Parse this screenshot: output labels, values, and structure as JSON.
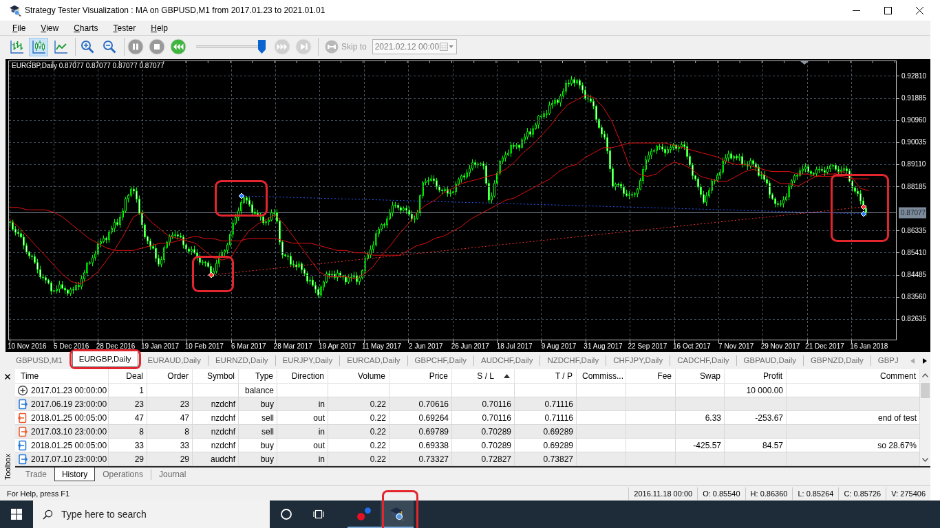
{
  "window": {
    "title": "Strategy Tester Visualization : MA on GBPUSD,M1 from 2017.01.23 to 2021.01.01"
  },
  "menu": [
    "File",
    "View",
    "Charts",
    "Tester",
    "Help"
  ],
  "toolbar": {
    "chart_modes": [
      {
        "kind": "bars",
        "selected": false
      },
      {
        "kind": "candles",
        "selected": true
      },
      {
        "kind": "line",
        "selected": false
      }
    ],
    "zoom": [
      {
        "kind": "zoom-in"
      },
      {
        "kind": "zoom-out"
      }
    ],
    "playback": [
      {
        "kind": "pause",
        "disabled": false
      },
      {
        "kind": "stop",
        "disabled": false
      },
      {
        "kind": "rewind",
        "disabled": false
      }
    ],
    "speed": {
      "level": 0.96
    },
    "stepping": [
      {
        "kind": "fast-forward",
        "disabled": true
      },
      {
        "kind": "skip-end",
        "disabled": true
      }
    ],
    "skip_to": {
      "label": "Skip to",
      "disabled": true
    },
    "date_field": {
      "value": "2021.02.12 00:00",
      "disabled": true
    }
  },
  "chart": {
    "info": "EURGBP,Daily 0.87077 0.87077 0.87077 0.87077",
    "current_price": "0.87077",
    "chart_data": {
      "type": "line",
      "grid": true,
      "categories": [
        null,
        null,
        "10 Nov 2016",
        null,
        null,
        null,
        null,
        "5 Dec 2016",
        null,
        null,
        null,
        null,
        "28 Dec 2016",
        null,
        null,
        null,
        null,
        "19 Jan 2017",
        null,
        null,
        null,
        null,
        "10 Feb 2017",
        null,
        null,
        null,
        null,
        "6 Mar 2017",
        null,
        null,
        null,
        null,
        "28 Mar 2017",
        null,
        null,
        null,
        null,
        "19 Apr 2017",
        null,
        null,
        null,
        null,
        "11 May 2017",
        null,
        null,
        null,
        null,
        "2 Jun 2017",
        null,
        null,
        null,
        null,
        "26 Jun 2017",
        null,
        null,
        null,
        null,
        "18 Jul 2017",
        null,
        null,
        null,
        null,
        "9 Aug 2017",
        null,
        null,
        null,
        null,
        "31 Aug 2017",
        null,
        null,
        null,
        null,
        "22 Sep 2017",
        null,
        null,
        null,
        null,
        "16 Oct 2017",
        null,
        null,
        null,
        null,
        "7 Nov 2017",
        null,
        null,
        null,
        null,
        "29 Nov 2017",
        null,
        null,
        null,
        null,
        "21 Dec 2017",
        null,
        null,
        null,
        null,
        "16 Jan 2018"
      ],
      "ylim": [
        0.8175,
        0.9344
      ],
      "yticks": [
        {
          "value": 0.9281,
          "label": "0.92810"
        },
        {
          "value": 0.91885,
          "label": "0.91885"
        },
        {
          "value": 0.9096,
          "label": "0.90960"
        },
        {
          "value": 0.90035,
          "label": "0.90035"
        },
        {
          "value": 0.8911,
          "label": "0.89110"
        },
        {
          "value": 0.88185,
          "label": "0.88185"
        },
        {
          "value": 0.86335,
          "label": "0.86335"
        },
        {
          "value": 0.8541,
          "label": "0.85410"
        },
        {
          "value": 0.84485,
          "label": "0.84485"
        },
        {
          "value": 0.8356,
          "label": "0.83560"
        },
        {
          "value": 0.82635,
          "label": "0.82635"
        }
      ],
      "series": [
        {
          "color": "#e01010",
          "values": [
            0.868,
            0.865,
            0.861,
            0.857,
            0.853,
            0.849,
            0.845,
            0.842,
            0.841,
            0.843,
            0.846,
            0.851,
            0.856,
            0.862,
            0.869,
            0.871,
            0.867,
            0.864,
            0.861,
            0.86,
            0.859,
            0.858,
            0.855,
            0.852,
            0.851,
            0.852,
            0.858,
            0.863,
            0.866,
            0.868,
            0.87,
            0.866,
            0.861,
            0.856,
            0.851,
            0.846,
            0.844,
            0.844,
            0.844,
            0.843,
            0.845,
            0.848,
            0.853,
            0.857,
            0.862,
            0.866,
            0.871,
            0.874,
            0.876,
            0.879,
            0.881,
            0.883,
            0.884,
            0.885,
            0.886,
            0.887,
            0.889,
            0.892,
            0.896,
            0.899,
            0.903,
            0.907,
            0.912,
            0.916,
            0.918,
            0.92,
            0.919,
            0.915,
            0.909,
            0.9,
            0.89,
            0.887,
            0.886,
            0.887,
            0.89,
            0.892,
            0.891,
            0.889,
            0.886,
            0.885,
            0.884,
            0.884,
            0.886,
            0.888,
            0.889,
            0.887,
            0.885,
            0.883,
            0.883,
            0.882,
            0.884,
            0.886,
            0.887,
            0.887,
            0.888,
            0.886,
            0.881,
            0.88
          ]
        },
        {
          "color": "#e01010",
          "values": [
            0.873,
            0.873,
            0.872,
            0.872,
            0.872,
            0.871,
            0.869,
            0.866,
            0.863,
            0.86,
            0.858,
            0.856,
            0.855,
            0.855,
            0.855,
            0.856,
            0.857,
            0.858,
            0.858,
            0.859,
            0.86,
            0.861,
            0.86,
            0.86,
            0.859,
            0.859,
            0.859,
            0.86,
            0.86,
            0.86,
            0.86,
            0.859,
            0.858,
            0.858,
            0.858,
            0.857,
            0.856,
            0.855,
            0.855,
            0.854,
            0.854,
            0.853,
            0.853,
            0.853,
            0.853,
            0.855,
            0.857,
            0.858,
            0.86,
            0.861,
            0.863,
            0.865,
            0.868,
            0.87,
            0.872,
            0.874,
            0.876,
            0.877,
            0.879,
            0.881,
            0.883,
            0.885,
            0.888,
            0.89,
            0.891,
            0.894,
            0.896,
            0.898,
            0.898,
            0.899,
            0.9,
            0.9,
            0.9,
            0.9,
            0.9,
            0.899,
            0.898,
            0.897,
            0.896,
            0.895,
            0.894,
            0.892,
            0.891,
            0.891,
            0.89,
            0.889,
            0.888,
            0.888,
            0.888,
            0.887,
            0.887,
            0.886,
            0.886,
            0.886,
            0.886,
            0.885,
            0.885,
            0.885
          ]
        }
      ]
    }
  },
  "symbol_tabs": {
    "tabs": [
      {
        "label": "GBPUSD,M1",
        "selected": false
      },
      {
        "label": "EURGBP,Daily",
        "selected": true
      },
      {
        "label": "EURAUD,Daily",
        "selected": false
      },
      {
        "label": "EURNZD,Daily",
        "selected": false
      },
      {
        "label": "EURJPY,Daily",
        "selected": false
      },
      {
        "label": "EURCAD,Daily",
        "selected": false
      },
      {
        "label": "GBPCHF,Daily",
        "selected": false
      },
      {
        "label": "AUDCHF,Daily",
        "selected": false
      },
      {
        "label": "NZDCHF,Daily",
        "selected": false
      },
      {
        "label": "CHFJPY,Daily",
        "selected": false
      },
      {
        "label": "CADCHF,Daily",
        "selected": false
      },
      {
        "label": "GBPAUD,Daily",
        "selected": false
      },
      {
        "label": "GBPNZD,Daily",
        "selected": false
      },
      {
        "label": "GBPJ",
        "selected": false
      }
    ],
    "scroll_buttons": [
      {
        "kind": "left",
        "disabled": true
      },
      {
        "kind": "right",
        "disabled": false
      }
    ]
  },
  "toolbox": {
    "title": "Toolbox",
    "table": {
      "columns": [
        {
          "label": "Time",
          "sorted": false
        },
        {
          "label": "Deal",
          "sorted": false
        },
        {
          "label": "Order",
          "sorted": false
        },
        {
          "label": "Symbol",
          "sorted": false
        },
        {
          "label": "Type",
          "sorted": false
        },
        {
          "label": "Direction",
          "sorted": false
        },
        {
          "label": "Volume",
          "sorted": false
        },
        {
          "label": "Price",
          "sorted": false
        },
        {
          "label": "S / L",
          "sorted": true
        },
        {
          "label": "T / P",
          "sorted": false
        },
        {
          "label": "Commiss...",
          "sorted": false
        },
        {
          "label": "Fee",
          "sorted": false
        },
        {
          "label": "Swap",
          "sorted": false
        },
        {
          "label": "Profit",
          "sorted": false
        },
        {
          "label": "Comment",
          "sorted": false
        }
      ],
      "rows": [
        {
          "kind": "balance",
          "time": "2017.01.23 00:00:00",
          "deal": "1",
          "type": "balance",
          "profit": "10 000.00"
        },
        {
          "kind": "buy-in",
          "time": "2017.06.19 23:00:00",
          "deal": "23",
          "order": "23",
          "symbol": "nzdchf",
          "type": "buy",
          "direction": "in",
          "volume": "0.22",
          "price": "0.70616",
          "sl": "0.70116",
          "tp": "0.71116"
        },
        {
          "kind": "sell-out",
          "time": "2018.01.25 00:05:00",
          "deal": "47",
          "order": "47",
          "symbol": "nzdchf",
          "type": "sell",
          "direction": "out",
          "volume": "0.22",
          "price": "0.69264",
          "sl": "0.70116",
          "tp": "0.71116",
          "swap": "6.33",
          "profit": "-253.67",
          "comment": "end of test"
        },
        {
          "kind": "sell-in",
          "time": "2017.03.10 23:00:00",
          "deal": "8",
          "order": "8",
          "symbol": "nzdchf",
          "type": "sell",
          "direction": "in",
          "volume": "0.22",
          "price": "0.69789",
          "sl": "0.70289",
          "tp": "0.69289"
        },
        {
          "kind": "buy-out",
          "time": "2018.01.25 00:05:00",
          "deal": "33",
          "order": "33",
          "symbol": "nzdchf",
          "type": "buy",
          "direction": "out",
          "volume": "0.22",
          "price": "0.69338",
          "sl": "0.70289",
          "tp": "0.69289",
          "swap": "-425.57",
          "profit": "84.57",
          "comment": "so 28.67%"
        },
        {
          "kind": "buy-in",
          "time": "2017.07.10 23:00:00",
          "deal": "29",
          "order": "29",
          "symbol": "audchf",
          "type": "buy",
          "direction": "in",
          "volume": "0.22",
          "price": "0.73327",
          "sl": "0.72827",
          "tp": "0.73827"
        }
      ]
    },
    "tabs": [
      {
        "label": "Trade",
        "selected": false
      },
      {
        "label": "History",
        "selected": true
      },
      {
        "label": "Operations",
        "selected": false
      },
      {
        "label": "Journal",
        "selected": false
      }
    ]
  },
  "status_bar": {
    "help": "For Help, press F1",
    "fields": [
      "2016.11.18 00:00",
      "O: 0.85540",
      "H: 0.86360",
      "L: 0.85264",
      "C: 0.85726",
      "V: 275406"
    ]
  },
  "taskbar": {
    "search": {
      "placeholder": "Type here to search"
    },
    "apps": [
      {
        "kind": "dots",
        "active": false,
        "running": true
      },
      {
        "kind": "tester",
        "active": true,
        "running": true
      }
    ]
  }
}
